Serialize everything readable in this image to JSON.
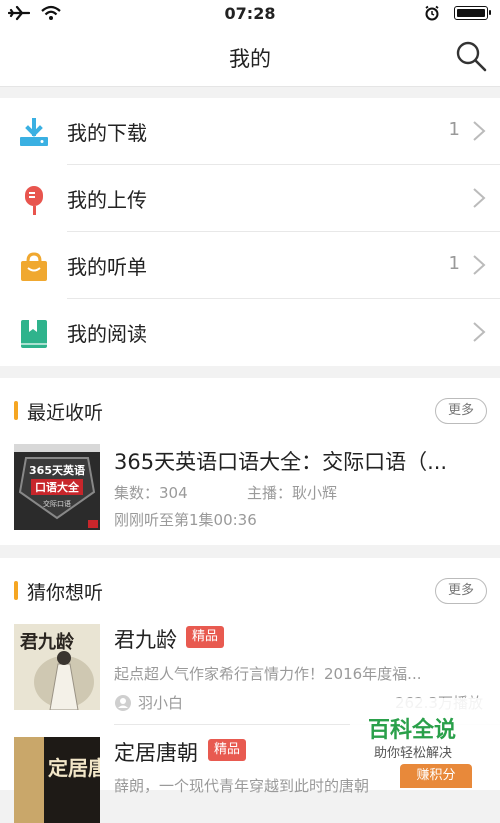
{
  "status_bar": {
    "time": "07:28"
  },
  "nav": {
    "title": "我的"
  },
  "menu": [
    {
      "label": "我的下载",
      "count": "1",
      "icon": "download-icon",
      "color": "#3ab0e2"
    },
    {
      "label": "我的上传",
      "count": "",
      "icon": "microphone-icon",
      "color": "#e8554e"
    },
    {
      "label": "我的听单",
      "count": "1",
      "icon": "bag-icon",
      "color": "#f0a830"
    },
    {
      "label": "我的阅读",
      "count": "",
      "icon": "book-icon",
      "color": "#2fb38c"
    }
  ],
  "recent": {
    "title": "最近收听",
    "more": "更多",
    "item": {
      "title": "365天英语口语大全：交际口语（...",
      "episodes": "集数：304",
      "host": "主播：耿小辉",
      "progress": "刚刚听至第1集00:36",
      "cover_text": [
        "365天英语",
        "口语大全",
        "交际口语"
      ]
    }
  },
  "guess": {
    "title": "猜你想听",
    "more": "更多",
    "items": [
      {
        "title": "君九龄",
        "tag": "精品",
        "desc": "起点超人气作家希行言情力作！2016年度福...",
        "author": "羽小白",
        "plays": "262.3万播放",
        "cover_text": "君九龄"
      },
      {
        "title": "定居唐朝",
        "tag": "精品",
        "desc": "薛朗，一个现代青年穿越到此时的唐朝",
        "cover_text": "定居唐朝"
      }
    ]
  },
  "watermark": {
    "title": "百科全说",
    "subtitle": "助你轻松解决",
    "button": "赚积分"
  },
  "colors": {
    "accent": "#f5a623",
    "tag": "#e85a50"
  }
}
